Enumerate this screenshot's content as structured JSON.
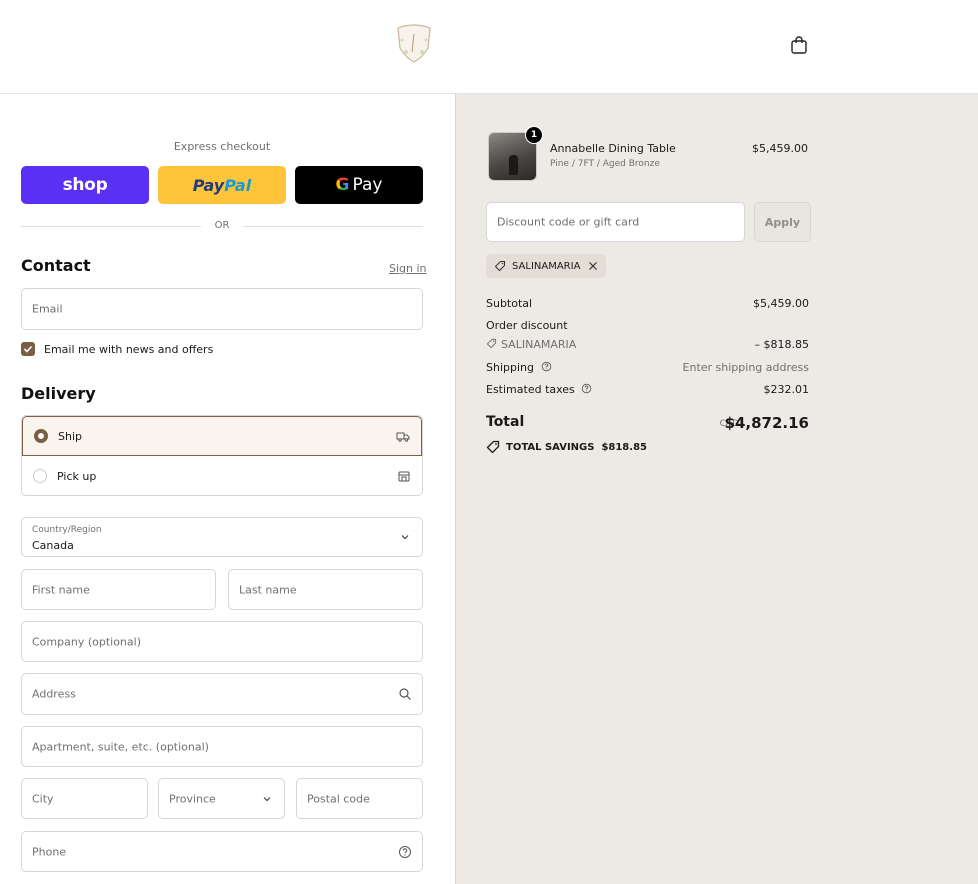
{
  "header": {
    "logo_icon": "brand-crest-icon",
    "cart_icon": "shopping-bag-icon"
  },
  "express": {
    "title": "Express checkout",
    "shop_label": "shop",
    "paypal_part1": "Pay",
    "paypal_part2": "Pal",
    "gpay_g": "G",
    "gpay_label": "Pay",
    "or_label": "OR"
  },
  "contact": {
    "heading": "Contact",
    "signin_label": "Sign in",
    "email_placeholder": "Email",
    "newsletter_label": "Email me with news and offers",
    "newsletter_checked": true
  },
  "delivery": {
    "heading": "Delivery",
    "options": [
      {
        "label": "Ship",
        "selected": true,
        "icon": "truck-icon"
      },
      {
        "label": "Pick up",
        "selected": false,
        "icon": "store-icon"
      }
    ],
    "country_label": "Country/Region",
    "country_value": "Canada",
    "first_name_placeholder": "First name",
    "last_name_placeholder": "Last name",
    "company_placeholder": "Company (optional)",
    "address_placeholder": "Address",
    "apartment_placeholder": "Apartment, suite, etc. (optional)",
    "city_placeholder": "City",
    "province_placeholder": "Province",
    "postal_placeholder": "Postal code",
    "phone_placeholder": "Phone"
  },
  "order": {
    "item": {
      "name": "Annabelle Dining Table",
      "variant": "Pine / 7FT / Aged Bronze",
      "price": "$5,459.00",
      "quantity": "1"
    },
    "discount_placeholder": "Discount code or gift card",
    "apply_label": "Apply",
    "applied_code": "SALINAMARIA",
    "subtotal_label": "Subtotal",
    "subtotal_value": "$5,459.00",
    "order_discount_label": "Order discount",
    "discount_code": "SALINAMARIA",
    "discount_value": "– $818.85",
    "shipping_label": "Shipping",
    "shipping_value": "Enter shipping address",
    "taxes_label": "Estimated taxes",
    "taxes_value": "$232.01",
    "total_label": "Total",
    "currency": "CAD",
    "total_value": "$4,872.16",
    "savings_label": "TOTAL SAVINGS",
    "savings_value": "$818.85"
  },
  "colors": {
    "accent": "#7a5f43",
    "shop_purple": "#5a31f4",
    "paypal_yellow": "#ffc439",
    "summary_bg": "#ede9e5"
  }
}
